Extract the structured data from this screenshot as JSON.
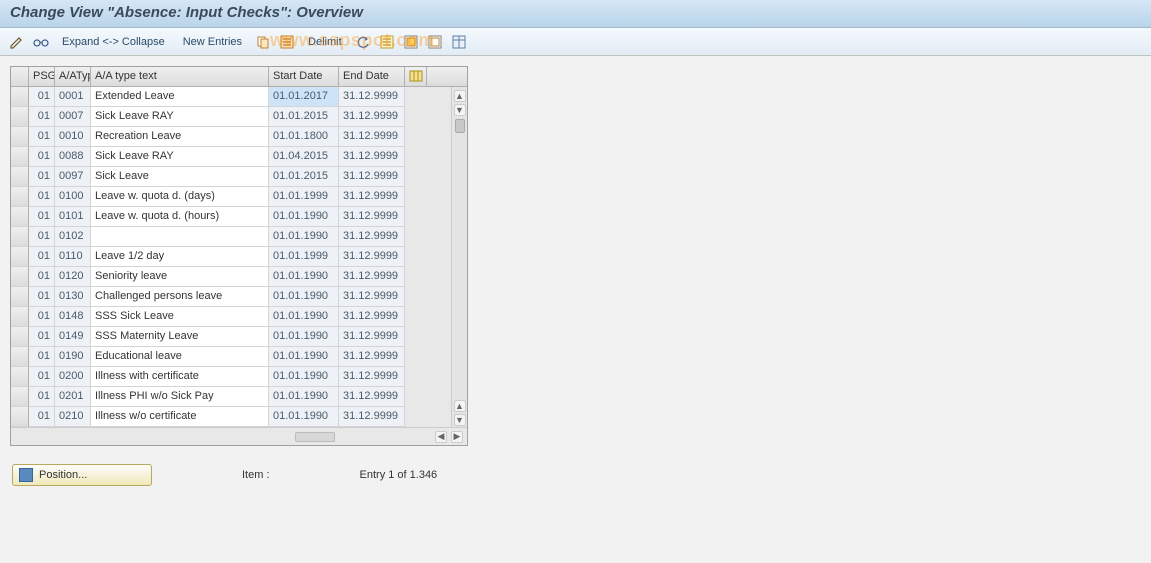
{
  "title": "Change View \"Absence: Input Checks\": Overview",
  "toolbar": {
    "expand_collapse": "Expand <-> Collapse",
    "new_entries": "New Entries",
    "delimit": "Delimit"
  },
  "watermark": "www.sapspot.com",
  "columns": {
    "sel": "",
    "psg": "PSG",
    "aa_type": "A/AType",
    "aa_text": "A/A type text",
    "start": "Start Date",
    "end": "End Date"
  },
  "rows": [
    {
      "psg": "01",
      "type": "0001",
      "text": "Extended Leave",
      "start": "01.01.2017",
      "end": "31.12.9999",
      "sel": true
    },
    {
      "psg": "01",
      "type": "0007",
      "text": "Sick Leave RAY",
      "start": "01.01.2015",
      "end": "31.12.9999"
    },
    {
      "psg": "01",
      "type": "0010",
      "text": "Recreation Leave",
      "start": "01.01.1800",
      "end": "31.12.9999"
    },
    {
      "psg": "01",
      "type": "0088",
      "text": "Sick Leave RAY",
      "start": "01.04.2015",
      "end": "31.12.9999"
    },
    {
      "psg": "01",
      "type": "0097",
      "text": "Sick Leave",
      "start": "01.01.2015",
      "end": "31.12.9999"
    },
    {
      "psg": "01",
      "type": "0100",
      "text": "Leave w. quota d. (days)",
      "start": "01.01.1999",
      "end": "31.12.9999"
    },
    {
      "psg": "01",
      "type": "0101",
      "text": "Leave w. quota d. (hours)",
      "start": "01.01.1990",
      "end": "31.12.9999"
    },
    {
      "psg": "01",
      "type": "0102",
      "text": "",
      "start": "01.01.1990",
      "end": "31.12.9999"
    },
    {
      "psg": "01",
      "type": "0110",
      "text": "Leave 1/2 day",
      "start": "01.01.1999",
      "end": "31.12.9999"
    },
    {
      "psg": "01",
      "type": "0120",
      "text": "Seniority leave",
      "start": "01.01.1990",
      "end": "31.12.9999"
    },
    {
      "psg": "01",
      "type": "0130",
      "text": "Challenged persons leave",
      "start": "01.01.1990",
      "end": "31.12.9999"
    },
    {
      "psg": "01",
      "type": "0148",
      "text": "SSS Sick Leave",
      "start": "01.01.1990",
      "end": "31.12.9999"
    },
    {
      "psg": "01",
      "type": "0149",
      "text": "SSS Maternity Leave",
      "start": "01.01.1990",
      "end": "31.12.9999"
    },
    {
      "psg": "01",
      "type": "0190",
      "text": "Educational leave",
      "start": "01.01.1990",
      "end": "31.12.9999"
    },
    {
      "psg": "01",
      "type": "0200",
      "text": "Illness with certificate",
      "start": "01.01.1990",
      "end": "31.12.9999"
    },
    {
      "psg": "01",
      "type": "0201",
      "text": "Illness PHI w/o Sick Pay",
      "start": "01.01.1990",
      "end": "31.12.9999"
    },
    {
      "psg": "01",
      "type": "0210",
      "text": "Illness w/o certificate",
      "start": "01.01.1990",
      "end": "31.12.9999"
    }
  ],
  "footer": {
    "position_label": "Position...",
    "item_label": "Item   :",
    "entry_label": "Entry 1 of 1.346"
  }
}
